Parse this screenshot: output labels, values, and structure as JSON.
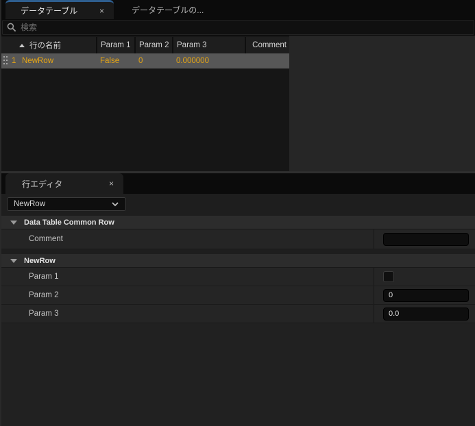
{
  "colors": {
    "accent_blue": "#2e5e8e",
    "gold_text": "#e7a614",
    "selected_row_bg": "#575757"
  },
  "top_tabs": {
    "active": {
      "label": "データテーブル",
      "close_glyph": "×"
    },
    "inactive": {
      "label": "データテーブルの..."
    }
  },
  "search": {
    "placeholder": "検索"
  },
  "table": {
    "columns": {
      "name": "行の名前",
      "param1": "Param 1",
      "param2": "Param 2",
      "param3": "Param 3",
      "comment": "Comment"
    },
    "sort": {
      "column": "行の名前",
      "direction": "ascending"
    },
    "rows": [
      {
        "num": "1",
        "name": "NewRow",
        "param1": "False",
        "param2": "0",
        "param3": "0.000000",
        "comment": ""
      }
    ]
  },
  "row_editor": {
    "tab": {
      "label": "行エディタ",
      "close_glyph": "×"
    },
    "row_select": {
      "value": "NewRow"
    },
    "sections": [
      {
        "title": "Data Table Common Row",
        "fields": [
          {
            "label": "Comment",
            "type": "text",
            "value": ""
          }
        ]
      },
      {
        "title": "NewRow",
        "fields": [
          {
            "label": "Param 1",
            "type": "checkbox",
            "checked": false
          },
          {
            "label": "Param 2",
            "type": "text",
            "value": "0"
          },
          {
            "label": "Param 3",
            "type": "text",
            "value": "0.0"
          }
        ]
      }
    ]
  }
}
